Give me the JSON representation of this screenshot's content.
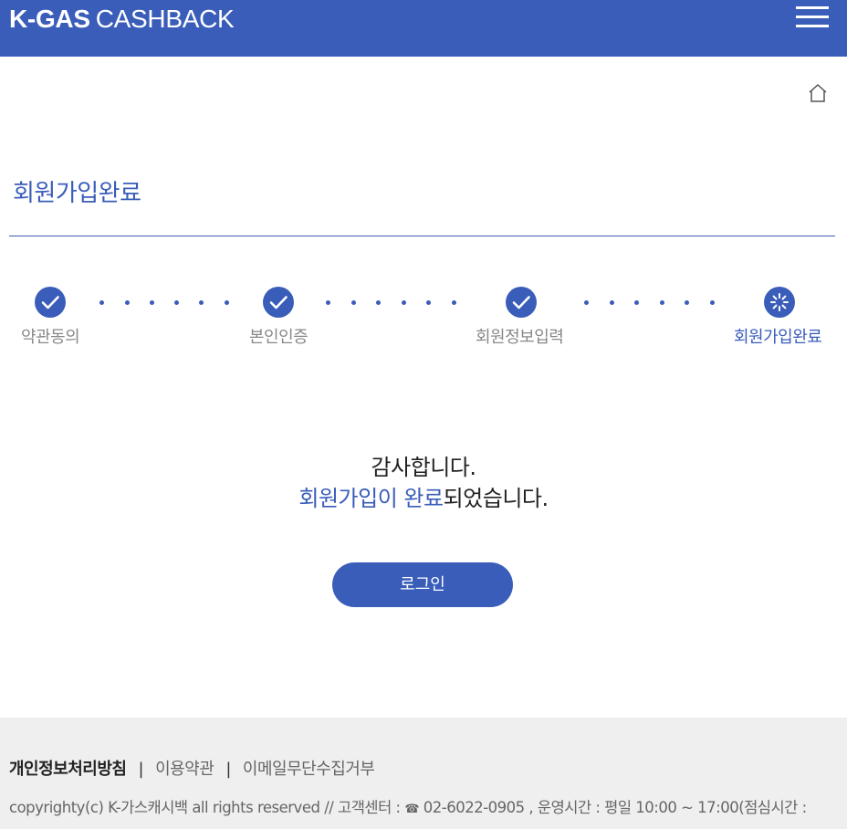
{
  "header": {
    "logo_bold": "K-GAS",
    "logo_light": "CASHBACK",
    "brand_color": "#3a5dba"
  },
  "page": {
    "title": "회원가입완료"
  },
  "steps": [
    {
      "label": "약관동의",
      "status": "completed",
      "icon": "check-circle-icon"
    },
    {
      "label": "본인인증",
      "status": "completed",
      "icon": "check-circle-icon"
    },
    {
      "label": "회원정보입력",
      "status": "completed",
      "icon": "check-circle-icon"
    },
    {
      "label": "회원가입완료",
      "status": "current",
      "icon": "loading-spinner-icon"
    }
  ],
  "message": {
    "line1": "감사합니다.",
    "line2_highlight": "회원가입이 완료",
    "line2_rest": "되었습니다."
  },
  "login_button": {
    "label": "로그인"
  },
  "footer": {
    "links": [
      {
        "label": "개인정보처리방침",
        "emphasis": true
      },
      {
        "label": "이용약관",
        "emphasis": false
      },
      {
        "label": "이메일무단수집거부",
        "emphasis": false
      }
    ],
    "separator": "|",
    "copyright_prefix": "copyrighty(c) K-가스캐시백 all rights reserved // 고객센터 :",
    "phone_icon": "☎",
    "copyright_suffix": "02-6022-0905 , 운영시간 : 평일 10:00 ~ 17:00(점심시간 :"
  }
}
